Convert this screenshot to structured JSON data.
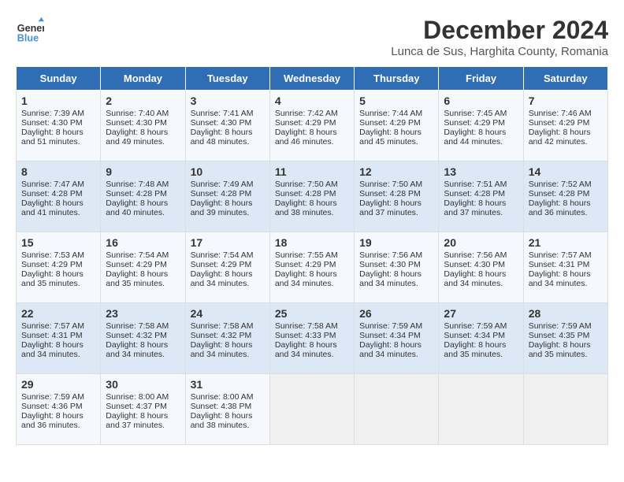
{
  "logo": {
    "line1": "General",
    "line2": "Blue"
  },
  "title": "December 2024",
  "subtitle": "Lunca de Sus, Harghita County, Romania",
  "headers": [
    "Sunday",
    "Monday",
    "Tuesday",
    "Wednesday",
    "Thursday",
    "Friday",
    "Saturday"
  ],
  "weeks": [
    [
      {
        "day": "1",
        "rise": "7:39 AM",
        "set": "4:30 PM",
        "daylight": "8 hours and 51 minutes."
      },
      {
        "day": "2",
        "rise": "7:40 AM",
        "set": "4:30 PM",
        "daylight": "8 hours and 49 minutes."
      },
      {
        "day": "3",
        "rise": "7:41 AM",
        "set": "4:30 PM",
        "daylight": "8 hours and 48 minutes."
      },
      {
        "day": "4",
        "rise": "7:42 AM",
        "set": "4:29 PM",
        "daylight": "8 hours and 46 minutes."
      },
      {
        "day": "5",
        "rise": "7:44 AM",
        "set": "4:29 PM",
        "daylight": "8 hours and 45 minutes."
      },
      {
        "day": "6",
        "rise": "7:45 AM",
        "set": "4:29 PM",
        "daylight": "8 hours and 44 minutes."
      },
      {
        "day": "7",
        "rise": "7:46 AM",
        "set": "4:29 PM",
        "daylight": "8 hours and 42 minutes."
      }
    ],
    [
      {
        "day": "8",
        "rise": "7:47 AM",
        "set": "4:28 PM",
        "daylight": "8 hours and 41 minutes."
      },
      {
        "day": "9",
        "rise": "7:48 AM",
        "set": "4:28 PM",
        "daylight": "8 hours and 40 minutes."
      },
      {
        "day": "10",
        "rise": "7:49 AM",
        "set": "4:28 PM",
        "daylight": "8 hours and 39 minutes."
      },
      {
        "day": "11",
        "rise": "7:50 AM",
        "set": "4:28 PM",
        "daylight": "8 hours and 38 minutes."
      },
      {
        "day": "12",
        "rise": "7:50 AM",
        "set": "4:28 PM",
        "daylight": "8 hours and 37 minutes."
      },
      {
        "day": "13",
        "rise": "7:51 AM",
        "set": "4:28 PM",
        "daylight": "8 hours and 37 minutes."
      },
      {
        "day": "14",
        "rise": "7:52 AM",
        "set": "4:28 PM",
        "daylight": "8 hours and 36 minutes."
      }
    ],
    [
      {
        "day": "15",
        "rise": "7:53 AM",
        "set": "4:29 PM",
        "daylight": "8 hours and 35 minutes."
      },
      {
        "day": "16",
        "rise": "7:54 AM",
        "set": "4:29 PM",
        "daylight": "8 hours and 35 minutes."
      },
      {
        "day": "17",
        "rise": "7:54 AM",
        "set": "4:29 PM",
        "daylight": "8 hours and 34 minutes."
      },
      {
        "day": "18",
        "rise": "7:55 AM",
        "set": "4:29 PM",
        "daylight": "8 hours and 34 minutes."
      },
      {
        "day": "19",
        "rise": "7:56 AM",
        "set": "4:30 PM",
        "daylight": "8 hours and 34 minutes."
      },
      {
        "day": "20",
        "rise": "7:56 AM",
        "set": "4:30 PM",
        "daylight": "8 hours and 34 minutes."
      },
      {
        "day": "21",
        "rise": "7:57 AM",
        "set": "4:31 PM",
        "daylight": "8 hours and 34 minutes."
      }
    ],
    [
      {
        "day": "22",
        "rise": "7:57 AM",
        "set": "4:31 PM",
        "daylight": "8 hours and 34 minutes."
      },
      {
        "day": "23",
        "rise": "7:58 AM",
        "set": "4:32 PM",
        "daylight": "8 hours and 34 minutes."
      },
      {
        "day": "24",
        "rise": "7:58 AM",
        "set": "4:32 PM",
        "daylight": "8 hours and 34 minutes."
      },
      {
        "day": "25",
        "rise": "7:58 AM",
        "set": "4:33 PM",
        "daylight": "8 hours and 34 minutes."
      },
      {
        "day": "26",
        "rise": "7:59 AM",
        "set": "4:34 PM",
        "daylight": "8 hours and 34 minutes."
      },
      {
        "day": "27",
        "rise": "7:59 AM",
        "set": "4:34 PM",
        "daylight": "8 hours and 35 minutes."
      },
      {
        "day": "28",
        "rise": "7:59 AM",
        "set": "4:35 PM",
        "daylight": "8 hours and 35 minutes."
      }
    ],
    [
      {
        "day": "29",
        "rise": "7:59 AM",
        "set": "4:36 PM",
        "daylight": "8 hours and 36 minutes."
      },
      {
        "day": "30",
        "rise": "8:00 AM",
        "set": "4:37 PM",
        "daylight": "8 hours and 37 minutes."
      },
      {
        "day": "31",
        "rise": "8:00 AM",
        "set": "4:38 PM",
        "daylight": "8 hours and 38 minutes."
      },
      null,
      null,
      null,
      null
    ]
  ]
}
